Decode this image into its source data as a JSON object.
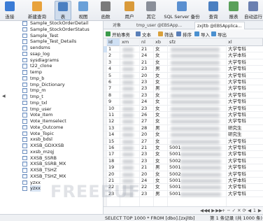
{
  "toolbar": {
    "buttons": [
      {
        "label": "连接",
        "icon": "connect-icon",
        "color": "#3a7bd5"
      },
      {
        "label": "新建查询",
        "icon": "new-query-icon",
        "color": "#e8a23b"
      },
      {
        "label": "表",
        "icon": "table-icon",
        "color": "#4a7fc1"
      },
      {
        "label": "视图",
        "icon": "view-icon",
        "color": "#6aa0d8"
      },
      {
        "label": "函数",
        "icon": "function-icon",
        "color": "#7a7a7a"
      },
      {
        "label": "用户",
        "icon": "user-icon",
        "color": "#d99a3a"
      },
      {
        "label": "其它",
        "icon": "other-icon",
        "color": "#8a8f99"
      },
      {
        "label": "SQL Server 备份",
        "icon": "backup-icon",
        "color": "#5a8fd0"
      },
      {
        "label": "查询",
        "icon": "query-icon",
        "color": "#4a7fc1"
      },
      {
        "label": "报表",
        "icon": "report-icon",
        "color": "#5aa05a"
      },
      {
        "label": "自动运行",
        "icon": "schedule-icon",
        "color": "#6a7fb0"
      }
    ]
  },
  "tree": {
    "tables": [
      "Sample_StockOrderDetail",
      "Sample_StockOrderStatus",
      "Sample_Test",
      "Sample_Test_Details",
      "sendsms",
      "ssap_log",
      "sysdiagrams",
      "t22_clone",
      "temp",
      "tmp_b",
      "tmp_Dictionary",
      "tmp_m",
      "tmp_t",
      "tmp_txl",
      "tmp_user",
      "Vote_Item",
      "Vote_Itemselect",
      "Vote_Outcome",
      "Vote_Topic",
      "xxsb_bdsl",
      "XXSB_GDXXSB",
      "xxsb_mzqj",
      "XXSB_SSRB",
      "XXSB_SSRB_MX",
      "XXSB_TSHZ",
      "XXSB_TSHZ_MX",
      "yzxx",
      "yzxx"
    ],
    "selected_index": 27
  },
  "tabs": [
    "对象",
    "tmp_user @EBSApp...",
    "zxjltb @EBSApplica..."
  ],
  "subtoolbar": [
    "开始事务",
    "文本",
    "筛选",
    "排序",
    "导入",
    "导出"
  ],
  "grid": {
    "columns": [
      "id",
      "xm",
      "nl",
      "xb",
      "sfz",
      "xl"
    ],
    "rows": [
      {
        "id": "1",
        "nl": "21",
        "xb": "女",
        "xl": "大学专科"
      },
      {
        "id": "2",
        "nl": "24",
        "xb": "女",
        "xl": "大学本科"
      },
      {
        "id": "3",
        "nl": "21",
        "xb": "女",
        "xl": "大学专科"
      },
      {
        "id": "4",
        "nl": "23",
        "xb": "男",
        "xl": "大学专科"
      },
      {
        "id": "5",
        "nl": "20",
        "xb": "女",
        "xl": "大学专科"
      },
      {
        "id": "6",
        "nl": "23",
        "xb": "女",
        "xl": "大学专科"
      },
      {
        "id": "7",
        "nl": "23",
        "xb": "男",
        "xl": "大学专科"
      },
      {
        "id": "8",
        "nl": "23",
        "xb": "女",
        "xl": "大学专科"
      },
      {
        "id": "9",
        "nl": "24",
        "xb": "女",
        "xl": "大学专科"
      },
      {
        "id": "10",
        "nl": "23",
        "xb": "女",
        "xl": "大学专科"
      },
      {
        "id": "11",
        "nl": "26",
        "xb": "女",
        "xl": "大学专科"
      },
      {
        "id": "12",
        "nl": "27",
        "xb": "女",
        "xl": "大学专科"
      },
      {
        "id": "13",
        "nl": "28",
        "xb": "男",
        "xl": "研究生"
      },
      {
        "id": "14",
        "nl": "20",
        "xb": "女",
        "xl": "研究生"
      },
      {
        "id": "15",
        "nl": "27",
        "xb": "女",
        "xl": "大学专科"
      },
      {
        "id": "16",
        "nl": "21",
        "xb": "女",
        "sfz": "5001",
        "xl": "大学专科"
      },
      {
        "id": "17",
        "nl": "23",
        "xb": "女",
        "sfz": "5001",
        "xl": "大学专科"
      },
      {
        "id": "18",
        "nl": "23",
        "xb": "女",
        "sfz": "5002",
        "xl": "大学专科"
      },
      {
        "id": "19",
        "nl": "21",
        "xb": "男",
        "sfz": "5001",
        "xl": "大学专科"
      },
      {
        "id": "20",
        "nl": "20",
        "xb": "女",
        "sfz": "5002",
        "xl": "大学专科"
      },
      {
        "id": "21",
        "nl": "24",
        "xb": "女",
        "sfz": "5001",
        "xl": "大学本科"
      },
      {
        "id": "22",
        "nl": "22",
        "xb": "女",
        "sfz": "5001",
        "xl": "大学专科"
      },
      {
        "id": "23",
        "nl": "23",
        "xb": "男",
        "sfz": "5001",
        "xl": "大学专科"
      }
    ]
  },
  "navbar": [
    "◀◀",
    "◀",
    "▶",
    "▶▶",
    "+",
    "−",
    "✓",
    "✕",
    "⟳",
    "◀",
    "1",
    "▶"
  ],
  "status": {
    "sql": "SELECT TOP 1000 * FROM [dbo].[zxjltb]",
    "records": "第 1 条记录 (共 1000 条)"
  },
  "watermark": "FREEBUF"
}
